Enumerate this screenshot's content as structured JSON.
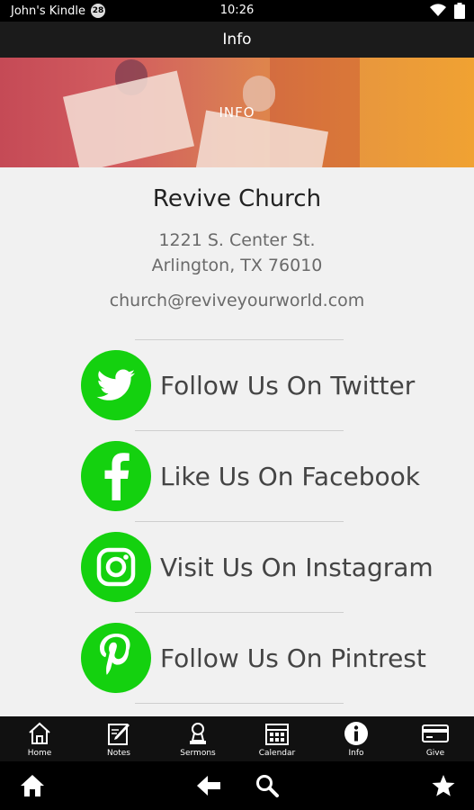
{
  "status": {
    "device": "John's Kindle",
    "notification_count": "28",
    "time": "10:26"
  },
  "title": "Info",
  "banner": {
    "label": "INFO"
  },
  "church": {
    "name": "Revive Church",
    "address_line1": "1221 S. Center St.",
    "address_line2": "Arlington, TX 76010",
    "email": "church@reviveyourworld.com"
  },
  "social": [
    {
      "icon": "twitter-icon",
      "label": "Follow Us On Twitter"
    },
    {
      "icon": "facebook-icon",
      "label": "Like Us On Facebook"
    },
    {
      "icon": "instagram-icon",
      "label": "Visit Us On Instagram"
    },
    {
      "icon": "pinterest-icon",
      "label": "Follow Us On Pintrest"
    }
  ],
  "tabs": [
    {
      "icon": "home-icon",
      "label": "Home"
    },
    {
      "icon": "notes-icon",
      "label": "Notes"
    },
    {
      "icon": "sermons-icon",
      "label": "Sermons"
    },
    {
      "icon": "calendar-icon",
      "label": "Calendar"
    },
    {
      "icon": "info-icon",
      "label": "Info"
    },
    {
      "icon": "give-icon",
      "label": "Give"
    }
  ],
  "colors": {
    "accent_green": "#14d10f",
    "title_bar": "#1b1b1b",
    "content_bg": "#f1f1f1"
  }
}
